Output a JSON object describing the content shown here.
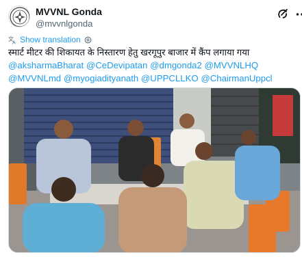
{
  "account": {
    "display_name": "MVVNL Gonda",
    "handle": "@mvvnlgonda",
    "avatar_icon": "mvvnl-logo-icon"
  },
  "actions": {
    "grok_icon": "grok-icon",
    "more_icon": "more-icon"
  },
  "translation": {
    "label": "Show translation",
    "icon": "translate-icon",
    "settings_icon": "gear-icon"
  },
  "tweet": {
    "text_line1": "स्मार्ट मीटर की शिकायत के निस्तारण हेतु खरगूपुर बाजार में कैंप लगाया गया",
    "mentions_line2": [
      "@aksharmaBharat",
      "@CeDevipatan",
      "@dmgonda2",
      "@MVVNLHQ"
    ],
    "mentions_line3": [
      "@MVVNLmd",
      "@myogiadityanath",
      "@UPPCLLKO",
      "@ChairmanUppcl"
    ]
  },
  "colors": {
    "link": "#1d9bf0",
    "text": "#0f1419",
    "secondary": "#536471"
  }
}
